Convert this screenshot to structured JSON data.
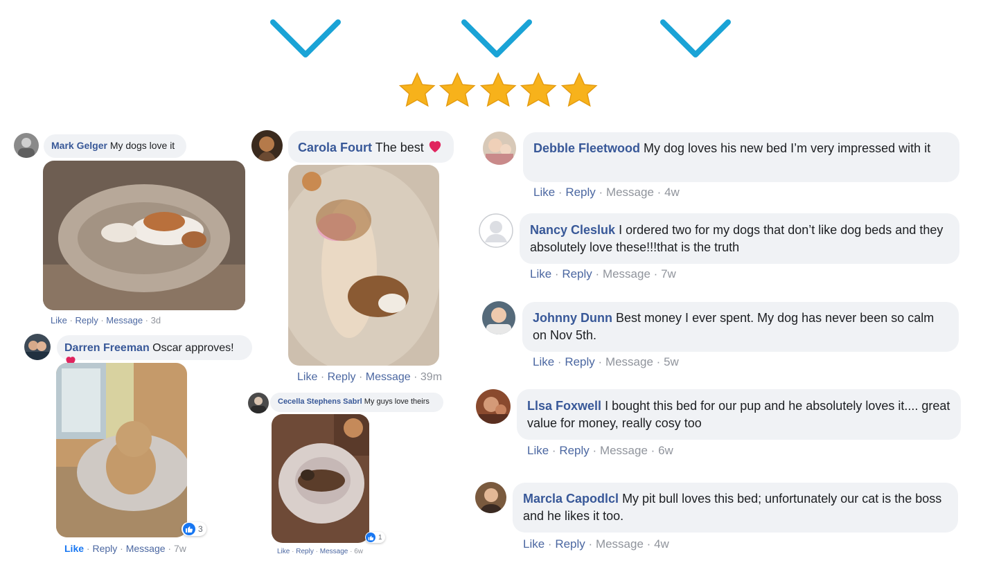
{
  "header": {
    "chevron_color": "#1aa3d6",
    "chevron_icon": "chevron-down-icon",
    "rating": {
      "value": 5,
      "max": 5,
      "star_color": "#f7b21b",
      "icon": "star-icon"
    }
  },
  "actions": {
    "like": "Like",
    "reply": "Reply",
    "message": "Message",
    "separator": "·"
  },
  "comments": {
    "mark": {
      "name": "Mark Gelger",
      "text": "My dogs love it",
      "time": "3d"
    },
    "carola": {
      "name": "Carola Fourt",
      "text": "The best",
      "time": "39m"
    },
    "darren": {
      "name": "Darren Freeman",
      "text": "Oscar approves!",
      "time": "7w",
      "reactions": "3"
    },
    "cecelia": {
      "name": "Cecella Stephens Sabrl",
      "text": "My guys love theirs",
      "time": "6w",
      "reactions": "1"
    },
    "debbie": {
      "name": "Debble Fleetwood",
      "text": "My dog loves his new bed I’m very impressed with it",
      "time": "4w"
    },
    "nancy": {
      "name": "Nancy Clesluk",
      "text": "I ordered two for my dogs that don’t like dog beds and they absolutely love these!!!that is the truth",
      "time": "7w"
    },
    "johnny": {
      "name": "Johnny Dunn",
      "text": "Best money I ever spent. My dog has never been so calm on Nov 5th.",
      "time": "5w"
    },
    "lisa": {
      "name": "Llsa Foxwell",
      "text": "I bought this bed for our pup and he absolutely loves it.... great value for money, really cosy too",
      "time": "6w"
    },
    "marcia": {
      "name": "Marcla Capodlcl",
      "text": "My pit bull loves this bed; unfortunately our cat is the boss and he likes it too.",
      "time": "4w"
    }
  }
}
